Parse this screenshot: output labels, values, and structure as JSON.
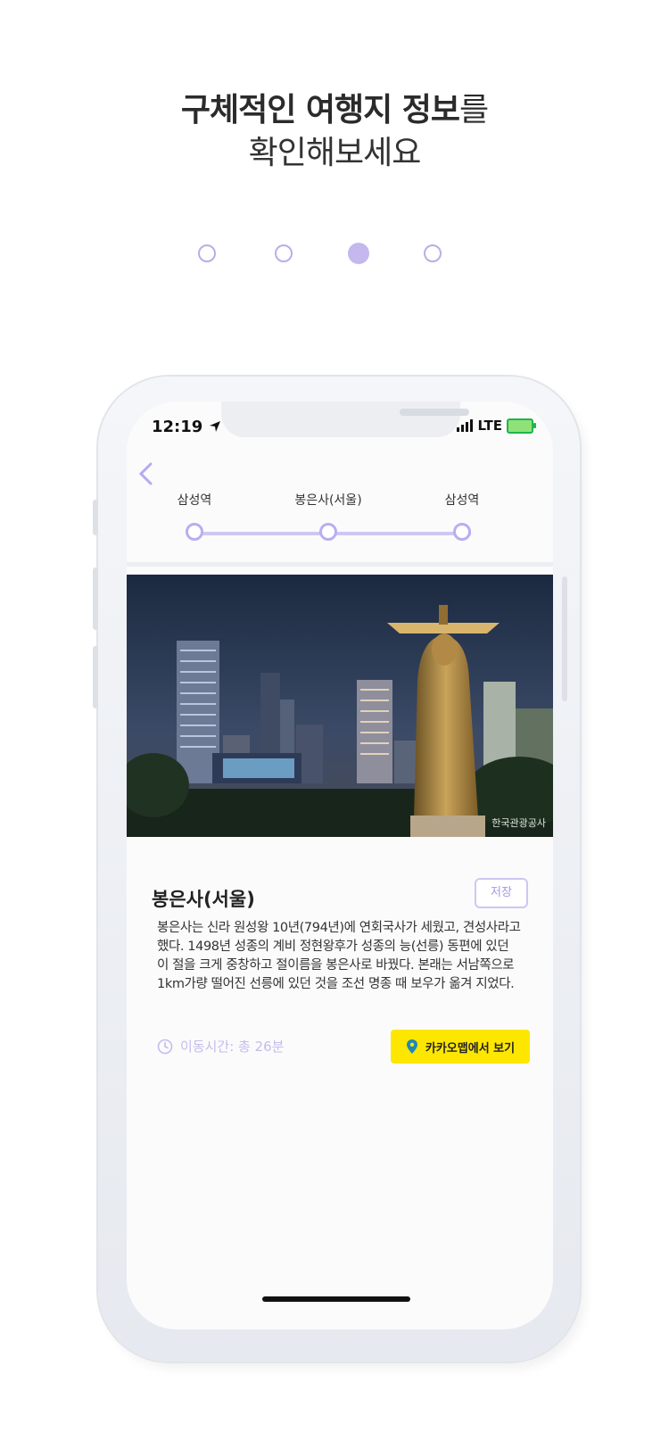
{
  "headline": {
    "line1_bold": "구체적인 여행지 정보",
    "line1_rest": "를",
    "line2": "확인해보세요"
  },
  "pager": {
    "count": 4,
    "active_index": 2
  },
  "status": {
    "time": "12:19",
    "network": "LTE"
  },
  "route": {
    "stops": [
      "삼성역",
      "봉은사(서울)",
      "삼성역"
    ]
  },
  "photo": {
    "credit": "한국관광공사"
  },
  "place": {
    "title": "봉은사(서울)",
    "save_label": "저장",
    "description": "봉은사는 신라 원성왕 10년(794년)에 연회국사가 세웠고, 견성사라고 했다. 1498년 성종의 계비 정현왕후가 성종의 능(선릉) 동편에 있던 이 절을 크게 중창하고 절이름을 봉은사로 바꿨다. 본래는 서남쪽으로 1km가량 떨어진 선릉에 있던 것을 조선 명종 때 보우가 옮겨 지었다.",
    "travel_time": "이동시간: 총 26분",
    "map_button": "카카오맵에서 보기"
  },
  "colors": {
    "accent": "#b9aef0",
    "kakao_yellow": "#fde600"
  }
}
